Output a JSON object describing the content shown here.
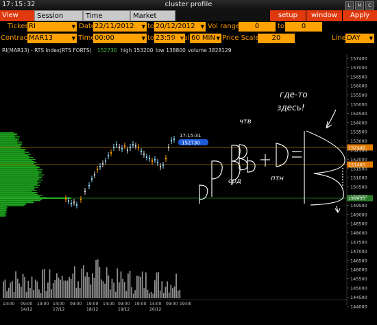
{
  "window": {
    "clock": "17:15:32",
    "title": "cluster profile",
    "buttons": [
      "L",
      "M",
      "C"
    ]
  },
  "tabs": [
    {
      "label": "View DOM",
      "active": true
    },
    {
      "label": "Session Hours",
      "active": false
    },
    {
      "label": "Time Interval",
      "active": false
    },
    {
      "label": "Market Watch",
      "active": false
    }
  ],
  "menu": {
    "setup": "setup",
    "window": "window",
    "apply": "Apply"
  },
  "row1": {
    "ticker_label": "Ticker",
    "ticker_value": "RI",
    "date_label": "Date",
    "date_from": "22/11/2012",
    "to_label": "to",
    "date_to": "20/12/2012",
    "vol_label": "Vol range",
    "vol_from": "0",
    "vol_to_label": "to",
    "vol_to": "0"
  },
  "row2": {
    "contract_label": "Contract",
    "contract_value": "MAR13",
    "time_label": "Time",
    "time_from": "00:00",
    "to_label": "to",
    "time_to": "23:59",
    "interval_label": "Interval",
    "interval_value": "60 MIN",
    "price_scale_label": "Price Scale",
    "price_scale_value": "20",
    "line_label": "Line",
    "line_value": "DAY"
  },
  "chart_header": {
    "symbol": "RI(MAR13) - RTS Index(RTS FORTS)",
    "last": "152730",
    "high": "high 153200",
    "low": "low 138800",
    "volume": "volume 3828129"
  },
  "price_axis": [
    "157400",
    "157000",
    "156500",
    "156000",
    "155500",
    "155000",
    "154500",
    "154000",
    "153500",
    "153000",
    "152500",
    "152000",
    "151500",
    "151000",
    "150500",
    "150000",
    "149500",
    "149000",
    "148500",
    "148000",
    "147500",
    "147000",
    "146500",
    "146000",
    "145500",
    "145000",
    "144500",
    "144000"
  ],
  "price_markers": [
    {
      "label": "152440",
      "color": "#e07a00"
    },
    {
      "label": "151460",
      "color": "#e07a00"
    },
    {
      "label": "149930",
      "color": "#2a7a2a"
    }
  ],
  "current_price": {
    "time": "17:15:31",
    "value": "152730"
  },
  "time_axis": [
    {
      "time": "14:00",
      "date": ""
    },
    {
      "time": "09:00",
      "date": "14/12"
    },
    {
      "time": "19:00",
      "date": ""
    },
    {
      "time": "14:00",
      "date": "17/12"
    },
    {
      "time": "09:00",
      "date": ""
    },
    {
      "time": "19:00",
      "date": "18/12"
    },
    {
      "time": "14:00",
      "date": ""
    },
    {
      "time": "09:00",
      "date": "19/12"
    },
    {
      "time": "19:00",
      "date": ""
    },
    {
      "time": "14:00",
      "date": "20/12"
    },
    {
      "time": "09:00",
      "date": ""
    },
    {
      "time": "19:00",
      "date": ""
    }
  ],
  "annotations": {
    "where_line1": "где-то",
    "where_line2": "здесь!",
    "thu": "чтв",
    "wed": "срд",
    "fri": "птн"
  },
  "colors": {
    "accent": "#e0390e",
    "field": "#ffa200",
    "label": "#ff9a00",
    "profile": "#1fa81f",
    "level_line": "#b06a00",
    "poc_line": "#1f8f1f"
  }
}
